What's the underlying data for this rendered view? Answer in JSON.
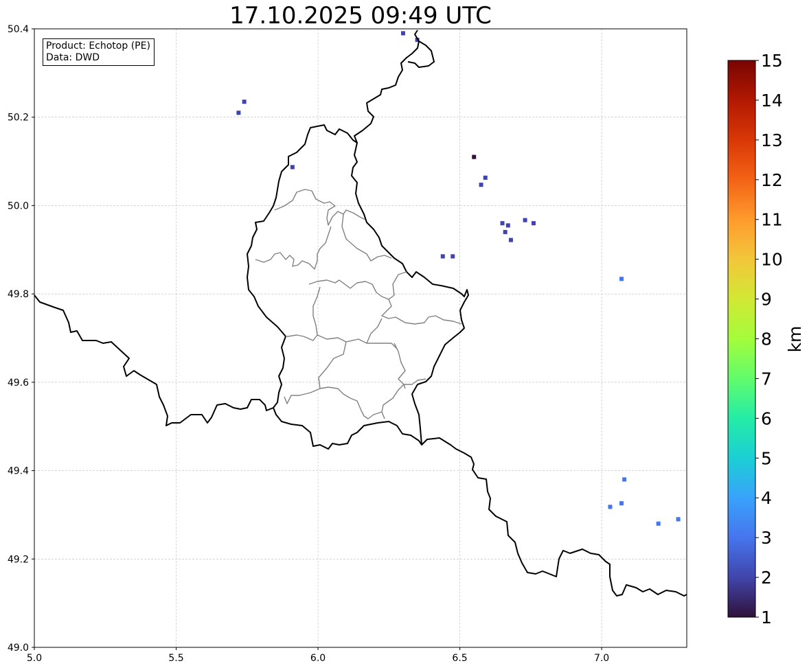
{
  "title": "17.10.2025 09:49 UTC",
  "info_box": {
    "product": "Product: Echotop (PE)",
    "data": "Data: DWD"
  },
  "axes": {
    "xlim": [
      5.0,
      7.3
    ],
    "ylim": [
      49.0,
      50.4
    ],
    "x_ticks": [
      "5.0",
      "5.5",
      "6.0",
      "6.5",
      "7.0"
    ],
    "y_ticks": [
      "49.0",
      "49.2",
      "49.4",
      "49.6",
      "49.8",
      "50.0",
      "50.2",
      "50.4"
    ],
    "grid": true
  },
  "colorbar": {
    "label": "km",
    "min": 1,
    "max": 15,
    "ticks": [
      "1",
      "2",
      "3",
      "4",
      "5",
      "6",
      "7",
      "8",
      "9",
      "10",
      "11",
      "12",
      "13",
      "14",
      "15"
    ],
    "colormap": "turbo",
    "colors": [
      "#30123b",
      "#4145ab",
      "#4675ed",
      "#39a2fc",
      "#1bcfd4",
      "#24eca6",
      "#61fc6c",
      "#a4fc3b",
      "#d1e834",
      "#f3c63a",
      "#fe9b2d",
      "#f36315",
      "#d93806",
      "#b11901",
      "#7a0402"
    ]
  },
  "map_layers": {
    "country_border_color": "#000000",
    "region_border_color": "#808080"
  },
  "chart_data": {
    "type": "heatmap",
    "title": "17.10.2025 09:49 UTC",
    "units": "km",
    "value_range": [
      1,
      15
    ],
    "cells": [
      {
        "lon": 5.72,
        "lat": 50.21,
        "value": 2.0
      },
      {
        "lon": 5.74,
        "lat": 50.235,
        "value": 2.0
      },
      {
        "lon": 5.91,
        "lat": 50.087,
        "value": 2.0
      },
      {
        "lon": 6.3,
        "lat": 50.39,
        "value": 1.8
      },
      {
        "lon": 6.35,
        "lat": 50.375,
        "value": 1.6
      },
      {
        "lon": 6.55,
        "lat": 50.11,
        "value": 1.2
      },
      {
        "lon": 6.59,
        "lat": 50.063,
        "value": 2.0
      },
      {
        "lon": 6.575,
        "lat": 50.047,
        "value": 2.0
      },
      {
        "lon": 6.44,
        "lat": 49.885,
        "value": 2.2
      },
      {
        "lon": 6.475,
        "lat": 49.885,
        "value": 2.2
      },
      {
        "lon": 6.65,
        "lat": 49.96,
        "value": 2.2
      },
      {
        "lon": 6.67,
        "lat": 49.955,
        "value": 2.2
      },
      {
        "lon": 6.66,
        "lat": 49.94,
        "value": 2.2
      },
      {
        "lon": 6.68,
        "lat": 49.922,
        "value": 2.0
      },
      {
        "lon": 6.73,
        "lat": 49.967,
        "value": 2.0
      },
      {
        "lon": 6.76,
        "lat": 49.96,
        "value": 2.2
      },
      {
        "lon": 7.07,
        "lat": 49.834,
        "value": 2.8
      },
      {
        "lon": 7.08,
        "lat": 49.38,
        "value": 2.8
      },
      {
        "lon": 7.03,
        "lat": 49.318,
        "value": 2.8
      },
      {
        "lon": 7.07,
        "lat": 49.326,
        "value": 2.6
      },
      {
        "lon": 7.2,
        "lat": 49.28,
        "value": 3.0
      },
      {
        "lon": 7.27,
        "lat": 49.29,
        "value": 3.0
      }
    ]
  }
}
